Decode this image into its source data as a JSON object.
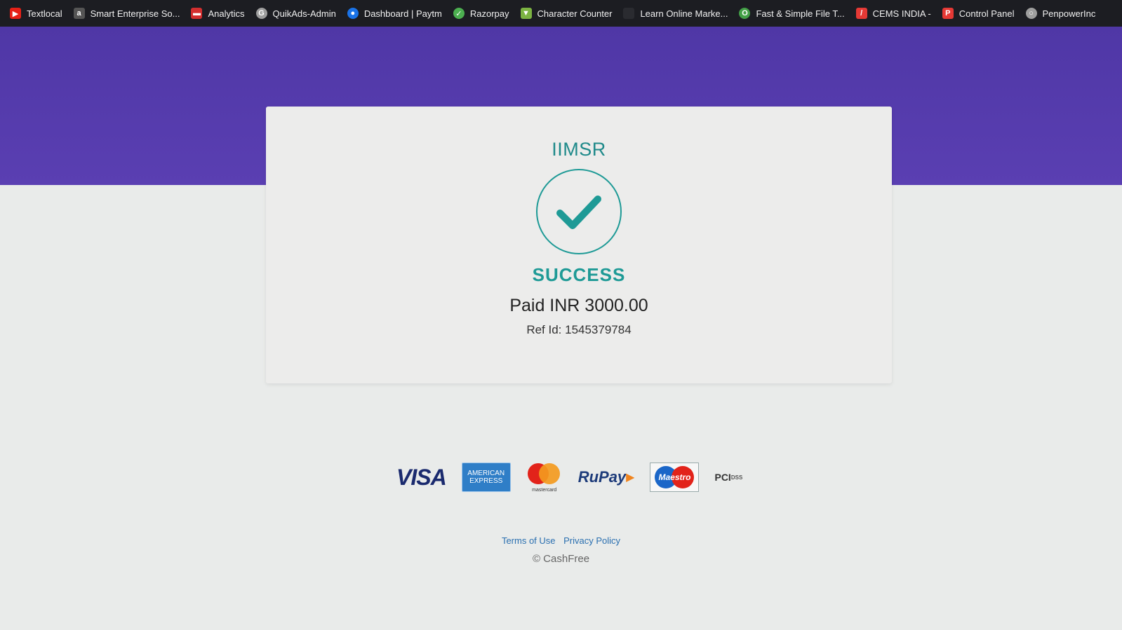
{
  "bookmarks": [
    {
      "label": "Textlocal",
      "icon": "youtube-icon",
      "color": "#e62117"
    },
    {
      "label": "Smart Enterprise So...",
      "icon": "a-icon",
      "color": "#555555"
    },
    {
      "label": "Analytics",
      "icon": "analytics-icon",
      "color": "#d32f2f"
    },
    {
      "label": "QuikAds-Admin",
      "icon": "google-icon",
      "color": "#9e9e9e"
    },
    {
      "label": "Dashboard | Paytm",
      "icon": "paytm-icon",
      "color": "#1a73e8"
    },
    {
      "label": "Razorpay",
      "icon": "check-circle-icon",
      "color": "#4caf50"
    },
    {
      "label": "Character Counter",
      "icon": "counter-icon",
      "color": "#7cb342"
    },
    {
      "label": "Learn Online Marke...",
      "icon": "page-icon",
      "color": "#1c1d22"
    },
    {
      "label": "Fast & Simple File T...",
      "icon": "ring-icon",
      "color": "#43a047"
    },
    {
      "label": "CEMS INDIA -",
      "icon": "cems-icon",
      "color": "#e53935"
    },
    {
      "label": "Control Panel",
      "icon": "p-icon",
      "color": "#e53935"
    },
    {
      "label": "PenpowerInc",
      "icon": "globe-icon",
      "color": "#9e9e9e"
    }
  ],
  "card": {
    "merchant": "IIMSR",
    "status": "SUCCESS",
    "amount_text": "Paid INR 3000.00",
    "ref_text": "Ref Id: 1545379784"
  },
  "payment_logos": {
    "visa": "VISA",
    "amex_line1": "AMERICAN",
    "amex_line2": "EXPRESS",
    "mastercard": "mastercard",
    "rupay": "RuPay",
    "maestro": "Maestro",
    "pci": "PCI",
    "pci_dss": "DSS"
  },
  "footer": {
    "terms": "Terms of Use",
    "privacy": "Privacy Policy",
    "copyright": "© CashFree"
  },
  "colors": {
    "header_band": "#5a3fb2",
    "accent": "#1e9a96",
    "link": "#2a6fb0"
  }
}
